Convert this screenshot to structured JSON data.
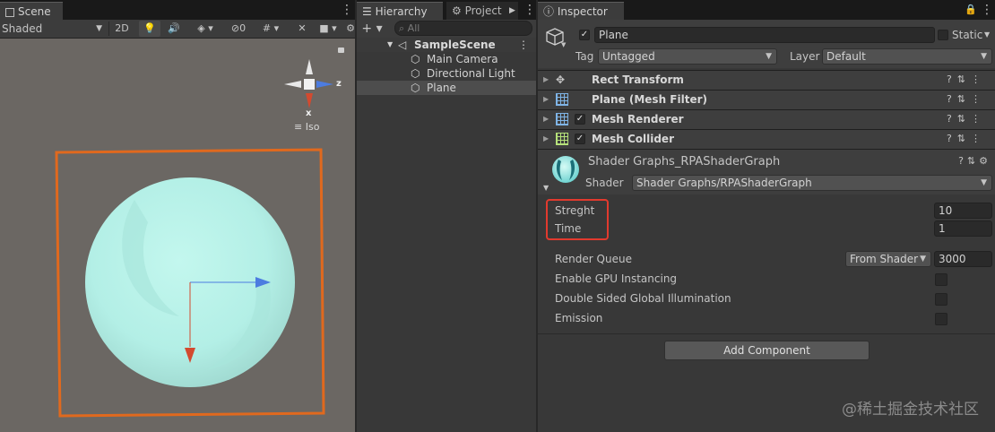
{
  "scene": {
    "tab_label": "Scene",
    "shading_mode": "Shaded",
    "mode_2d": "2D",
    "hidden_count": "0",
    "gizmo_axis_z": "z",
    "gizmo_axis_x": "x",
    "projection_label": "Iso"
  },
  "hierarchy": {
    "tab_label": "Hierarchy",
    "project_tab_label": "Project",
    "search_placeholder": "All",
    "scene_name": "SampleScene",
    "items": [
      "Main Camera",
      "Directional Light",
      "Plane"
    ]
  },
  "inspector": {
    "tab_label": "Inspector",
    "object_name": "Plane",
    "static_label": "Static",
    "tag_label": "Tag",
    "tag_value": "Untagged",
    "layer_label": "Layer",
    "layer_value": "Default",
    "components": [
      "Rect Transform",
      "Plane (Mesh Filter)",
      "Mesh Renderer",
      "Mesh Collider"
    ],
    "material": {
      "name": "Shader Graphs_RPAShaderGraph",
      "shader_label": "Shader",
      "shader_value": "Shader Graphs/RPAShaderGraph"
    },
    "properties": [
      {
        "label": "Streght",
        "value": "10"
      },
      {
        "label": "Time",
        "value": "1"
      }
    ],
    "render_queue_label": "Render Queue",
    "render_queue_mode": "From Shader",
    "render_queue_value": "3000",
    "gpu_instancing_label": "Enable GPU Instancing",
    "double_sided_label": "Double Sided Global Illumination",
    "emission_label": "Emission",
    "add_component_label": "Add Component"
  },
  "watermark": "@稀土掘金技术社区",
  "colors": {
    "selection_outline": "#e0691e",
    "highlight_box": "#e23a2e",
    "sphere": "#b8f3ea",
    "scene_bg": "#6b6763",
    "axis_x": "#d34a2f",
    "axis_z": "#4c7ce0"
  }
}
